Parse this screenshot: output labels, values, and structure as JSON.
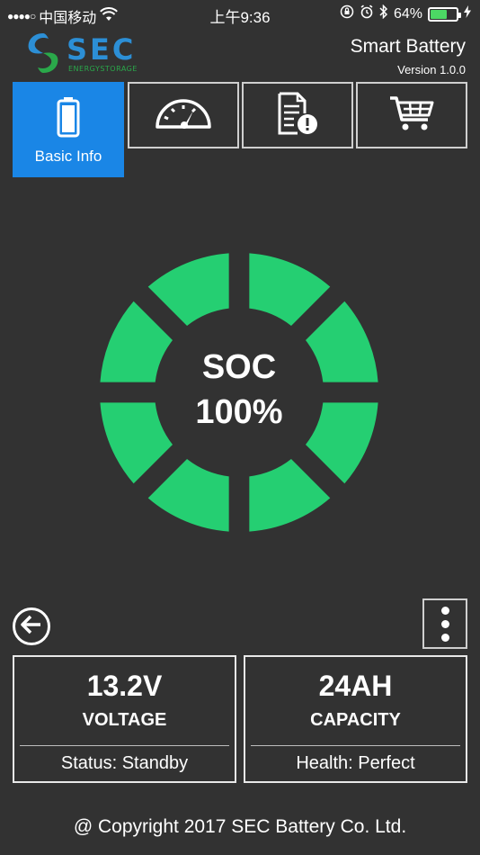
{
  "status_bar": {
    "signal": "●●●●○",
    "carrier": "中国移动",
    "time": "上午9:36",
    "battery_pct": "64%",
    "battery_level": 0.64
  },
  "header": {
    "logo_text": "SEC",
    "logo_sub": "ENERGYSTORAGE",
    "app_title": "Smart Battery",
    "version": "Version 1.0.0"
  },
  "tabs": [
    {
      "label": "Basic Info",
      "icon": "battery-icon",
      "active": true
    },
    {
      "label": "",
      "icon": "speedometer-icon",
      "active": false
    },
    {
      "label": "",
      "icon": "document-alert-icon",
      "active": false
    },
    {
      "label": "",
      "icon": "cart-icon",
      "active": false
    }
  ],
  "gauge": {
    "label": "SOC",
    "value": "100%",
    "soc_fraction": 1.0,
    "segments": 8,
    "color": "#25cf72"
  },
  "cards": {
    "voltage": {
      "value": "13.2V",
      "label": "VOLTAGE",
      "footer": "Status: Standby"
    },
    "capacity": {
      "value": "24AH",
      "label": "CAPACITY",
      "footer": "Health: Perfect"
    }
  },
  "footer": {
    "copyright": "@ Copyright 2017 SEC Battery Co. Ltd."
  },
  "colors": {
    "background": "#323232",
    "accent": "#1a86e6",
    "gauge": "#25cf72"
  }
}
